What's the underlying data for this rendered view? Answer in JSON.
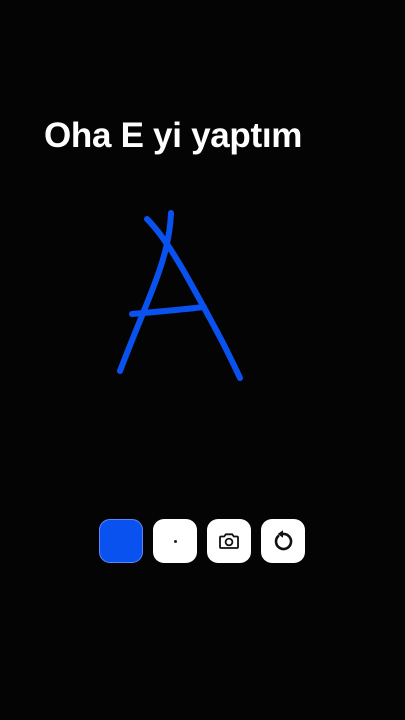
{
  "caption": "Oha E yi yaptım",
  "drawing": {
    "stroke_color": "#0a52f0"
  },
  "toolbar": {
    "items": [
      {
        "name": "color-swatch",
        "icon": "blue-color-swatch",
        "color": "#0a52f0"
      },
      {
        "name": "brush-size",
        "icon": "dot-icon"
      },
      {
        "name": "screenshot",
        "icon": "camera-icon"
      },
      {
        "name": "undo",
        "icon": "undo-icon"
      }
    ]
  }
}
